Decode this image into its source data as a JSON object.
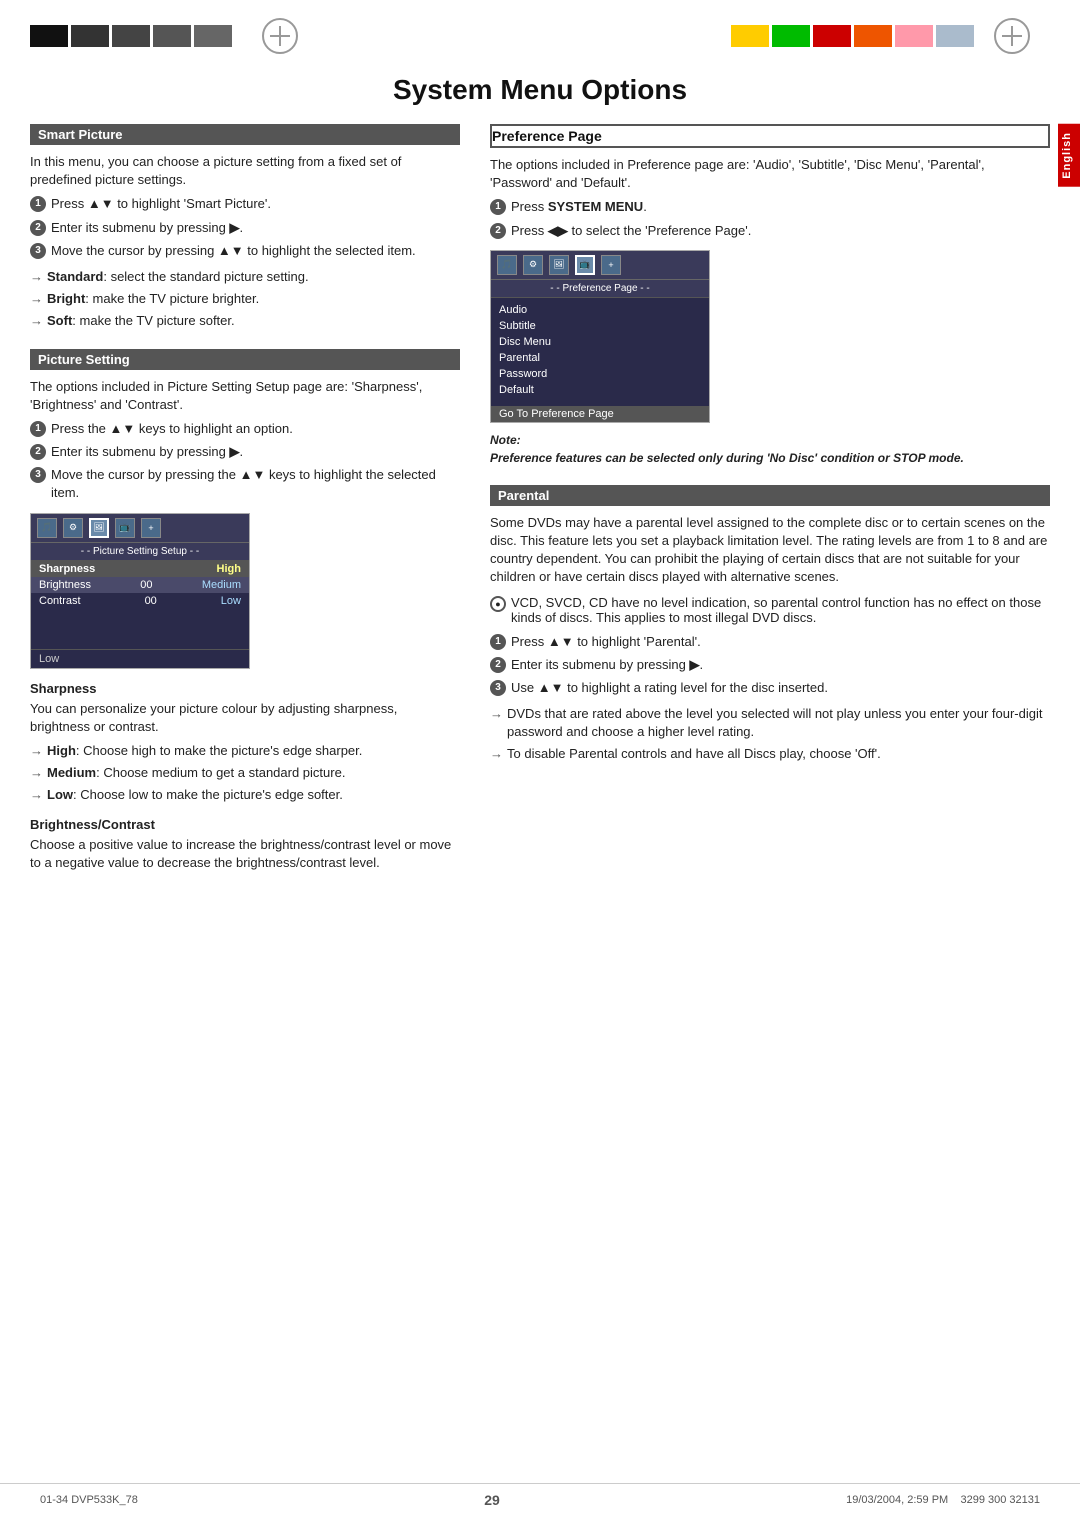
{
  "page": {
    "title": "System Menu Options",
    "page_number": "29",
    "footer_left": "01-34  DVP533K_78",
    "footer_center": "29",
    "footer_right": "19/03/2004, 2:59 PM",
    "footer_number": "3299 300 32131"
  },
  "top_bar": {
    "black_blocks": [
      "#111",
      "#333",
      "#444",
      "#555",
      "#666"
    ],
    "color_blocks_right": [
      "#ffcc00",
      "#00bb00",
      "#cc0000",
      "#ee4400",
      "#ff88aa",
      "#aabbcc"
    ]
  },
  "english_tab": "English",
  "smart_picture": {
    "header": "Smart Picture",
    "intro": "In this menu, you can choose a picture setting from a fixed set of predefined picture settings.",
    "steps": [
      "Press ▲▼ to highlight 'Smart Picture'.",
      "Enter its submenu by pressing ▶.",
      "Move the cursor by pressing ▲▼ to highlight the selected item."
    ],
    "arrows": [
      {
        "label": "Standard",
        "text": ": select the standard picture setting."
      },
      {
        "label": "Bright",
        "text": ": make the TV picture brighter."
      },
      {
        "label": "Soft",
        "text": ": make the TV picture softer."
      }
    ]
  },
  "picture_setting": {
    "header": "Picture Setting",
    "intro": "The options included in Picture Setting Setup page are: 'Sharpness', 'Brightness' and 'Contrast'.",
    "steps": [
      "Press the ▲▼ keys to highlight an option.",
      "Enter its submenu by pressing ▶.",
      "Move the cursor by pressing the ▲▼ keys to highlight the selected item."
    ],
    "menu": {
      "title": "- - Picture Setting Setup - -",
      "rows": [
        {
          "label": "Sharpness",
          "val1": "",
          "val2": "High",
          "class": "high"
        },
        {
          "label": "Brightness",
          "val1": "00",
          "val2": "Medium",
          "class": "medium"
        },
        {
          "label": "Contrast",
          "val1": "00",
          "val2": "Low",
          "class": "low"
        }
      ],
      "footer": "Low"
    },
    "sharpness_header": "Sharpness",
    "sharpness_text": "You can personalize your picture colour by adjusting sharpness, brightness or contrast.",
    "sharpness_arrows": [
      {
        "label": "High",
        "text": ": Choose high to make the picture's edge sharper."
      },
      {
        "label": "Medium",
        "text": ": Choose medium to get a standard picture."
      },
      {
        "label": "Low",
        "text": ": Choose low to make the picture's edge softer."
      }
    ],
    "brightness_header": "Brightness/Contrast",
    "brightness_text": "Choose a positive value to increase the brightness/contrast level or move to a negative value to decrease the brightness/contrast level."
  },
  "preference_page": {
    "header": "Preference Page",
    "intro": "The options included in Preference page are: 'Audio', 'Subtitle', 'Disc Menu', 'Parental', 'Password' and 'Default'.",
    "steps": [
      "Press SYSTEM MENU.",
      "Press ◀▶ to select the 'Preference Page'."
    ],
    "menu": {
      "title": "- - Preference Page - -",
      "items": [
        "Audio",
        "Subtitle",
        "Disc Menu",
        "Parental",
        "Password",
        "Default"
      ],
      "goto": "Go To Preference Page"
    },
    "note_label": "Note:",
    "note_text": "Preference features can be selected only during 'No Disc' condition or STOP mode."
  },
  "parental": {
    "header": "Parental",
    "intro": "Some DVDs may have a parental level assigned to the complete disc or to certain scenes on the disc. This feature lets you set a playback limitation level. The rating levels are from 1 to 8 and are country dependent. You can prohibit the playing of certain discs that are not suitable for your children or have certain discs played with alternative scenes.",
    "bullet": "VCD, SVCD, CD have no level indication, so parental control function has no effect on those kinds of discs. This applies to most illegal DVD discs.",
    "steps": [
      "Press ▲▼ to highlight 'Parental'.",
      "Enter its submenu by pressing ▶.",
      "Use ▲▼ to highlight a rating level for the disc inserted."
    ],
    "arrows": [
      {
        "label": "",
        "text": "DVDs that are rated above the level you selected will not play unless you enter your four-digit password and choose a higher level rating."
      },
      {
        "label": "",
        "text": "To disable Parental controls and have all Discs play, choose 'Off'."
      }
    ]
  }
}
